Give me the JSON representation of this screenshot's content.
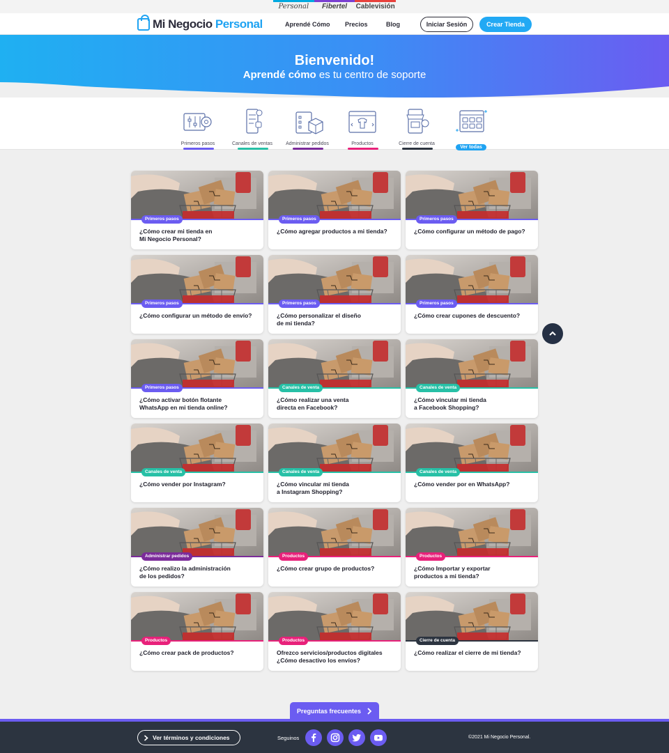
{
  "brands": [
    "Personal",
    "Fibertel",
    "Cablevisión"
  ],
  "header": {
    "logo_main": "Mi Negocio ",
    "logo_accent": "Personal",
    "nav": [
      "Aprendé Cómo",
      "Precios",
      "Blog"
    ],
    "login": "Iniciar Sesión",
    "create": "Crear Tienda"
  },
  "hero": {
    "title": "Bienvenido!",
    "subtitle_bold": "Aprendé cómo",
    "subtitle_rest": " es tu centro de soporte"
  },
  "categories": [
    {
      "label": "Primeros pasos",
      "color": "#6b5cf1",
      "icon": "sliders-gear-icon"
    },
    {
      "label": "Canales de ventas",
      "color": "#27c0a6",
      "icon": "mobile-channels-icon"
    },
    {
      "label": "Administrar pedidos",
      "color": "#7b2b9a",
      "icon": "orders-box-icon"
    },
    {
      "label": "Productos",
      "color": "#e8217a",
      "icon": "shirt-browser-icon"
    },
    {
      "label": "Cierre de cuenta",
      "color": "#2c3440",
      "icon": "store-close-icon"
    },
    {
      "label": "Ver todas",
      "color": "#1fa3f2",
      "icon": "grid-all-icon"
    }
  ],
  "tag_colors": {
    "Primeros pasos": "#6b5cf1",
    "Canales de venta": "#27c0a6",
    "Administrar pedidos": "#7b2b9a",
    "Productos": "#e8217a",
    "Cierre de cuenta": "#2c3440"
  },
  "cards": [
    {
      "tag": "Primeros pasos",
      "title": "¿Cómo crear mi tienda en\nMi Negocio Personal?"
    },
    {
      "tag": "Primeros pasos",
      "title": "¿Cómo agregar productos a mi tienda?"
    },
    {
      "tag": "Primeros pasos",
      "title": "¿Cómo configurar un método de pago?"
    },
    {
      "tag": "Primeros pasos",
      "title": "¿Cómo configurar un método de envío?"
    },
    {
      "tag": "Primeros pasos",
      "title": "¿Cómo personalizar el diseño\nde mi tienda?"
    },
    {
      "tag": "Primeros pasos",
      "title": "¿Cómo crear cupones de descuento?"
    },
    {
      "tag": "Primeros pasos",
      "title": "¿Cómo activar botón flotante\nWhatsApp en mi tienda online?"
    },
    {
      "tag": "Canales de venta",
      "title": "¿Cómo realizar una venta\ndirecta en Facebook?"
    },
    {
      "tag": "Canales de venta",
      "title": "¿Cómo vincular mi tienda\na Facebook Shopping?"
    },
    {
      "tag": "Canales de venta",
      "title": "¿Cómo vender por Instagram?"
    },
    {
      "tag": "Canales de venta",
      "title": "¿Cómo vincular mi tienda\na Instagram Shopping?"
    },
    {
      "tag": "Canales de venta",
      "title": "¿Cómo vender por en WhatsApp?"
    },
    {
      "tag": "Administrar pedidos",
      "title": "¿Cómo realizo la administración\nde los pedidos?"
    },
    {
      "tag": "Productos",
      "title": "¿Cómo crear grupo de productos?"
    },
    {
      "tag": "Productos",
      "title": "¿Cómo Importar y exportar\nproductos a mi tienda?"
    },
    {
      "tag": "Productos",
      "title": "¿Cómo crear pack de productos?"
    },
    {
      "tag": "Productos",
      "title": "Ofrezco servicios/productos digitales\n¿Cómo desactivo los envíos?"
    },
    {
      "tag": "Cierre de cuenta",
      "title": "¿Cómo realizar el cierre de mi tienda?"
    }
  ],
  "faq": "Preguntas frecuentes",
  "footer": {
    "terms": "Ver términos y condiciones",
    "follow": "Seguinos",
    "social": [
      "facebook-icon",
      "instagram-icon",
      "twitter-icon",
      "youtube-icon"
    ],
    "copyright": "©2021 Mi Negocio Personal."
  }
}
